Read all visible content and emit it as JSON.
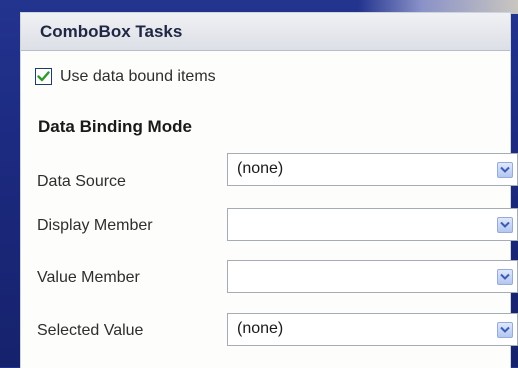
{
  "panel": {
    "title": "ComboBox Tasks",
    "use_data_bound": {
      "label": "Use data bound items",
      "checked": true
    },
    "section_title": "Data Binding Mode",
    "fields": [
      {
        "label": "Data Source",
        "value": "(none)"
      },
      {
        "label": "Display Member",
        "value": ""
      },
      {
        "label": "Value Member",
        "value": ""
      },
      {
        "label": "Selected Value",
        "value": "(none)"
      }
    ]
  },
  "icons": {
    "checkbox_check": "check-icon",
    "dropdown": "chevron-down-icon"
  },
  "colors": {
    "background": "#1c2a80",
    "panel": "#fdfdfb",
    "header": "#dcdfe6",
    "check": "#2f9a2f",
    "dropdown_arrow": "#3b5bb5"
  }
}
